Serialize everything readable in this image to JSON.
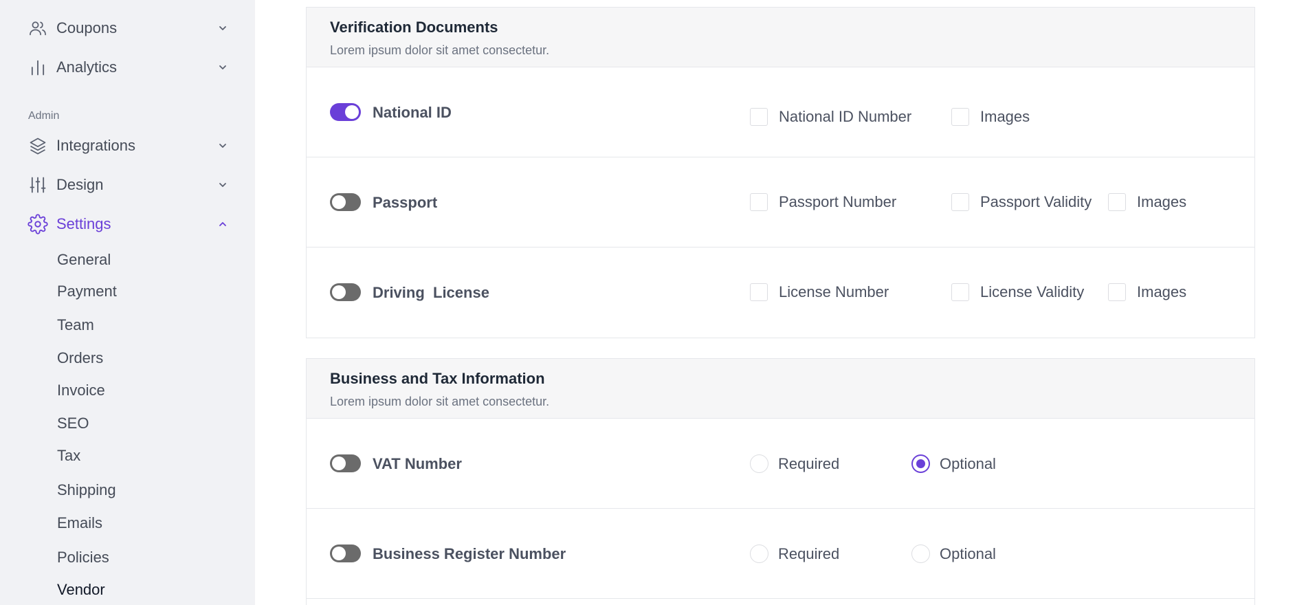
{
  "sidebar": {
    "items": [
      {
        "label": "Coupons",
        "icon": "users-icon"
      },
      {
        "label": "Analytics",
        "icon": "bar-chart-icon"
      },
      {
        "label": "Integrations",
        "icon": "layers-icon"
      },
      {
        "label": "Design",
        "icon": "sliders-icon"
      },
      {
        "label": "Settings",
        "icon": "gear-icon"
      }
    ],
    "section_admin": "Admin",
    "settings_sub": [
      "General",
      "Payment",
      "Team",
      "Orders",
      "Invoice",
      "SEO",
      "Tax",
      "Shipping",
      "Emails",
      "Policies",
      "Vendor"
    ],
    "accent_color": "#6a3fd8"
  },
  "verification": {
    "title": "Verification Documents",
    "subtitle": "Lorem ipsum dolor sit amet consectetur.",
    "rows": [
      {
        "label": "National ID",
        "enabled": true,
        "options": [
          "National ID Number",
          "Images"
        ]
      },
      {
        "label": "Passport",
        "enabled": false,
        "options": [
          "Passport Number",
          "Passport Validity",
          "Images"
        ]
      },
      {
        "label": "Driving  License",
        "enabled": false,
        "options": [
          "License Number",
          "License Validity",
          "Images"
        ]
      }
    ]
  },
  "business": {
    "title": "Business and Tax Information",
    "subtitle": "Lorem ipsum dolor sit amet consectetur.",
    "rows": [
      {
        "label": "VAT Number",
        "enabled": false,
        "options": [
          "Required",
          "Optional"
        ],
        "selected": "Optional"
      },
      {
        "label": "Business Register Number",
        "enabled": false,
        "options": [
          "Required",
          "Optional"
        ],
        "selected": ""
      }
    ]
  }
}
